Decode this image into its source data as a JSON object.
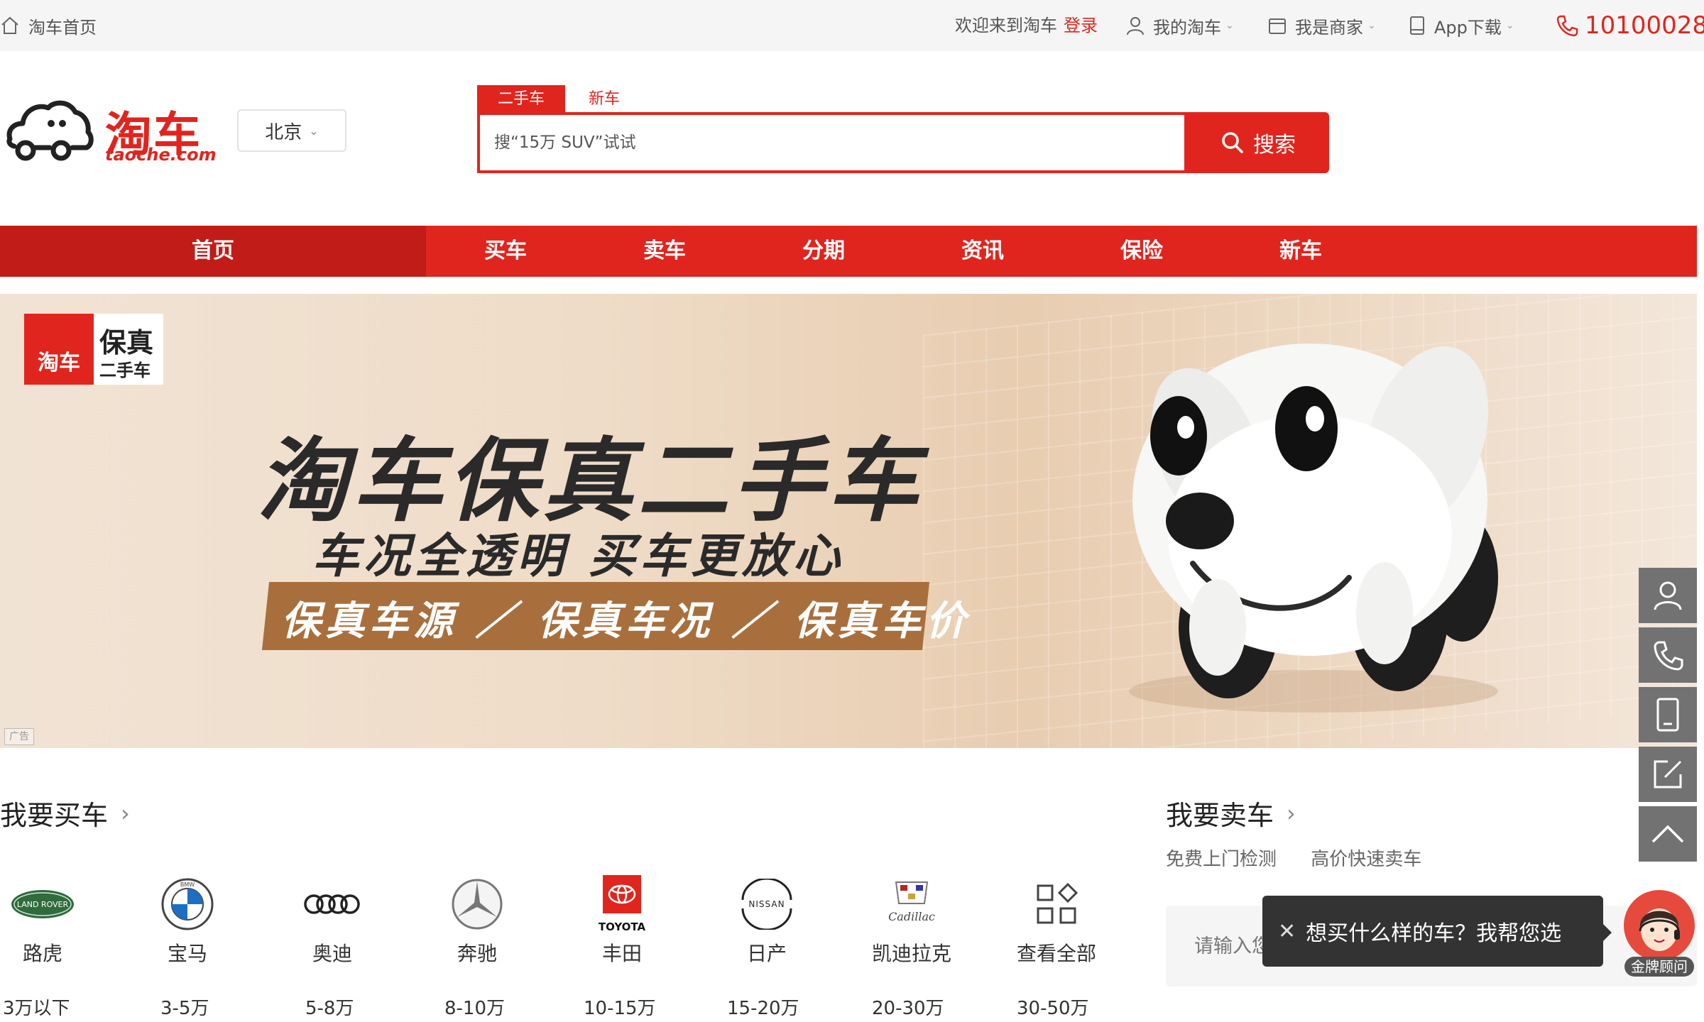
{
  "topbar": {
    "home_label": "淘车首页",
    "welcome_text": "欢迎来到淘车",
    "login_label": "登录",
    "my_taoche_label": "我的淘车",
    "merchant_label": "我是商家",
    "app_download_label": "App下载",
    "phone_number": "10100028"
  },
  "header": {
    "logo_text": "淘车",
    "logo_domain": "taoche.com",
    "city": "北京"
  },
  "search": {
    "tabs": [
      "二手车",
      "新车"
    ],
    "active_tab": "二手车",
    "placeholder": "搜“15万 SUV”试试",
    "button_label": "搜索"
  },
  "nav": {
    "items": [
      "首页",
      "买车",
      "卖车",
      "分期",
      "资讯",
      "保险",
      "新车"
    ],
    "active": "首页"
  },
  "banner": {
    "badge_logo": "淘车",
    "badge_title": "保真",
    "badge_subtitle": "二手车",
    "headline": "淘车保真二手车",
    "subheadline": "车况全透明  买车更放心",
    "strip_text": "保真车源 ／ 保真车况 ／ 保真车价",
    "ad_tag": "广告"
  },
  "buy": {
    "title": "我要买车",
    "brands": [
      {
        "name": "路虎",
        "icon": "land-rover-icon"
      },
      {
        "name": "宝马",
        "icon": "bmw-icon"
      },
      {
        "name": "奥迪",
        "icon": "audi-icon"
      },
      {
        "name": "奔驰",
        "icon": "mercedes-icon"
      },
      {
        "name": "丰田",
        "icon": "toyota-icon"
      },
      {
        "name": "日产",
        "icon": "nissan-icon"
      },
      {
        "name": "凯迪拉克",
        "icon": "cadillac-icon"
      },
      {
        "name": "查看全部",
        "icon": "grid-icon"
      }
    ],
    "brand_logo_text": {
      "land_rover": "LAND ROVER",
      "bmw": "BMW",
      "toyota": "TOYOTA",
      "nissan": "NISSAN",
      "cadillac": "Cadillac"
    },
    "price_ranges": [
      "3万以下",
      "3-5万",
      "5-8万",
      "8-10万",
      "10-15万",
      "15-20万",
      "20-30万",
      "30-50万"
    ]
  },
  "sell": {
    "title": "我要卖车",
    "links": [
      "免费上门检测",
      "高价快速卖车"
    ],
    "phone_placeholder": "请输入您的手机号"
  },
  "chat": {
    "message": "想买什么样的车？我帮您选",
    "advisor_label": "金牌顾问"
  },
  "colors": {
    "brand_red": "#e0251e",
    "nav_active": "#c21c18",
    "rail_gray": "#727272",
    "banner_strip": "#a86f3d"
  }
}
